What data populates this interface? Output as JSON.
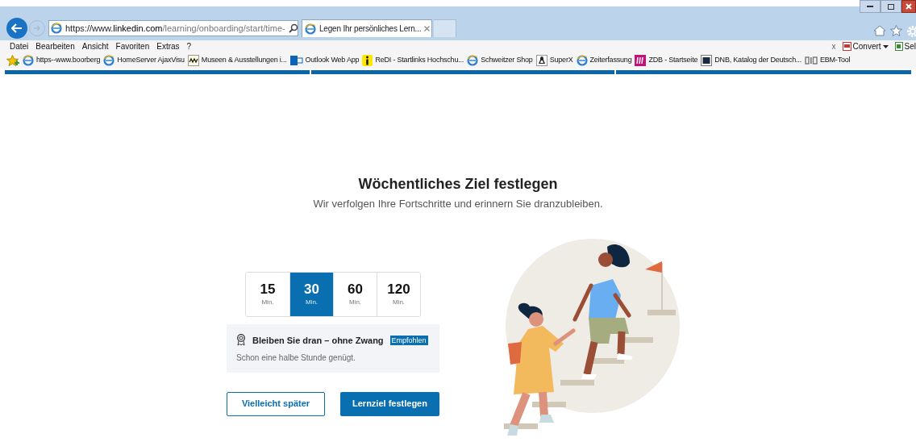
{
  "browser": {
    "address": {
      "scheme": "https://www.",
      "domain": "linkedin.com",
      "path": "/learning/onboarding/start/time-"
    },
    "tab": {
      "title": "Legen Ihr persönliches Lern...",
      "selected": true
    },
    "menu": [
      "Datei",
      "Bearbeiten",
      "Ansicht",
      "Favoriten",
      "Extras",
      "?"
    ],
    "toolbar_right": {
      "close": "x",
      "convert": "Convert",
      "select": "Sel"
    },
    "favorites": [
      {
        "kind": "ie",
        "label": "https--www.boorberg"
      },
      {
        "kind": "ie",
        "label": "HomeServer AjaxVisu"
      },
      {
        "kind": "museum",
        "label": "Museen & Ausstellungen i..."
      },
      {
        "kind": "outlook",
        "label": "Outlook Web App"
      },
      {
        "kind": "info",
        "label": "ReDI - Startlinks Hochschu..."
      },
      {
        "kind": "ie",
        "label": "Schweitzer Shop"
      },
      {
        "kind": "penguin",
        "label": "SuperX"
      },
      {
        "kind": "ie",
        "label": "Zeiterfassung"
      },
      {
        "kind": "zdb",
        "label": "ZDB - Startseite"
      },
      {
        "kind": "dnb",
        "label": "DNB, Katalog der Deutsch..."
      },
      {
        "kind": "big",
        "label": "EBM-Tool"
      }
    ]
  },
  "page": {
    "title": "Wöchentliches Ziel festlegen",
    "subtitle": "Wir verfolgen Ihre Fortschritte und erinnern Sie dranzubleiben.",
    "options": [
      {
        "value": "15",
        "unit": "Min.",
        "selected": false
      },
      {
        "value": "30",
        "unit": "Min.",
        "selected": true
      },
      {
        "value": "60",
        "unit": "Min.",
        "selected": false
      },
      {
        "value": "120",
        "unit": "Min.",
        "selected": false
      }
    ],
    "recommendation": {
      "title": "Bleiben Sie dran – ohne Zwang",
      "badge": "Empfohlen",
      "text": "Schon eine halbe Stunde genügt."
    },
    "buttons": [
      {
        "kind": "secondary",
        "label": "Vielleicht später"
      },
      {
        "kind": "primary",
        "label": "Lernziel festlegen"
      }
    ]
  }
}
